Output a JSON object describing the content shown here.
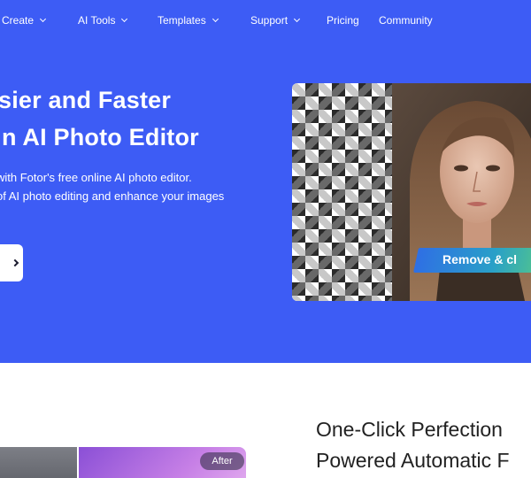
{
  "nav": {
    "items": [
      {
        "label": "Create",
        "dropdown": true
      },
      {
        "label": "AI Tools",
        "dropdown": true
      },
      {
        "label": "Templates",
        "dropdown": true
      },
      {
        "label": "Support",
        "dropdown": true
      },
      {
        "label": "Pricing",
        "dropdown": false
      },
      {
        "label": "Community",
        "dropdown": false
      }
    ]
  },
  "hero": {
    "title_line1": "sier and Faster",
    "title_line2": "n AI Photo Editor",
    "sub_line1": " with Fotor's free online AI photo editor.",
    "sub_line2": " of AI photo editing and enhance your images",
    "cta_icon": "arrow-right-icon"
  },
  "preview": {
    "ribbon_text": "Remove & cl"
  },
  "section": {
    "title_line1": "One-Click Perfection",
    "title_line2": "Powered Automatic F",
    "after_label": "After"
  },
  "colors": {
    "brand_blue": "#3d5cf5",
    "ribbon_start": "#2f6fe4",
    "ribbon_end": "#5ed07a"
  }
}
